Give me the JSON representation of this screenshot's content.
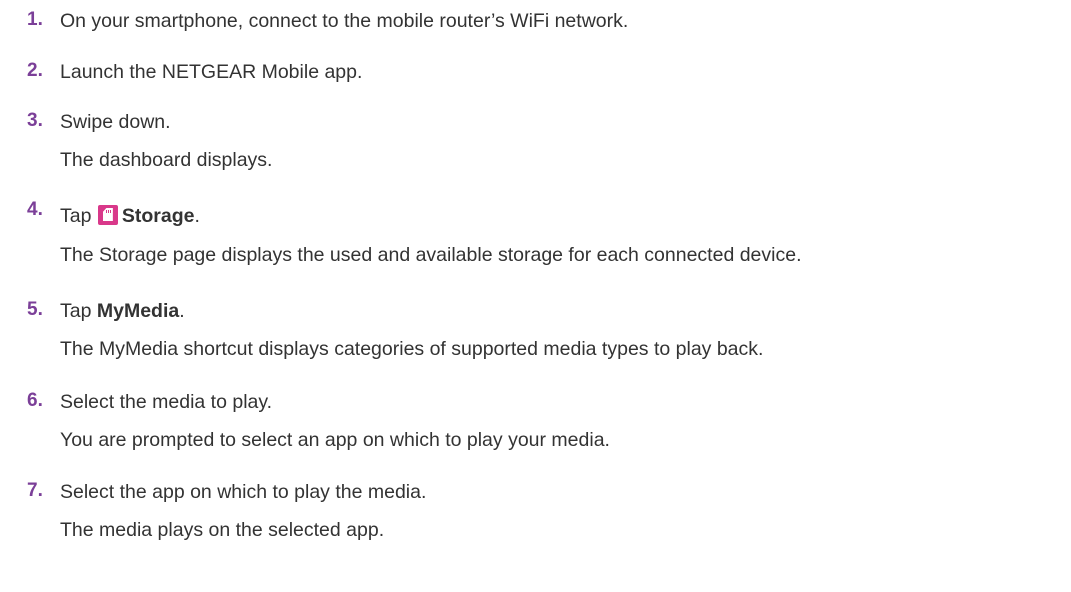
{
  "steps": [
    {
      "number": "1.",
      "text": "On your smartphone, connect to the mobile router’s WiFi network."
    },
    {
      "number": "2.",
      "text": "Launch the NETGEAR Mobile app."
    },
    {
      "number": "3.",
      "text": "Swipe down.",
      "result": "The dashboard displays."
    },
    {
      "number": "4.",
      "text_prefix": "Tap ",
      "icon": "storage-icon",
      "bold": "Storage",
      "text_suffix": ".",
      "result": "The Storage page displays the used and available storage for each connected device."
    },
    {
      "number": "5.",
      "text_prefix": "Tap ",
      "bold": "MyMedia",
      "text_suffix": ".",
      "result": "The MyMedia shortcut displays categories of supported media types to play back."
    },
    {
      "number": "6.",
      "text": "Select the media to play.",
      "result": "You are prompted to select an app on which to play your media."
    },
    {
      "number": "7.",
      "text": "Select the app on which to play the media.",
      "result": "The media plays on the selected app."
    }
  ],
  "colors": {
    "step_number": "#7b3f98",
    "body_text": "#333333",
    "storage_icon": "#d9388a"
  }
}
